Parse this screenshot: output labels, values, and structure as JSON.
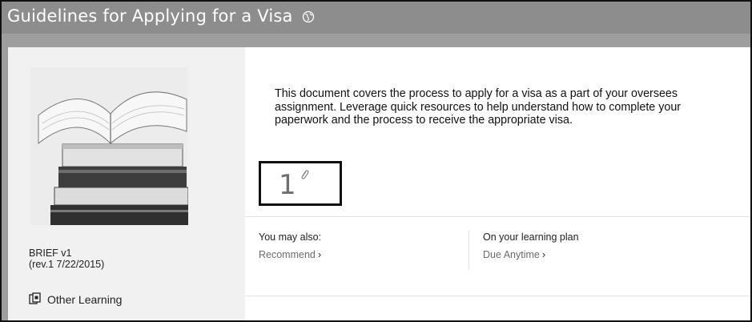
{
  "header": {
    "title": "Guidelines for Applying for a Visa",
    "title_icon": "globe-icon"
  },
  "sidebar": {
    "thumbnail": "books-image",
    "version_line1": "BRIEF v1",
    "version_line2": "(rev.1 7/22/2015)",
    "other_learning_label": "Other Learning",
    "other_learning_icon": "copy-document-icon"
  },
  "main": {
    "description": "This document covers the process to apply for a visa as a part of your oversees assignment. Leverage quick resources to help understand how to complete your paperwork and the process to receive the appropriate visa.",
    "attachment_count": "1",
    "attachment_icon": "paperclip-icon",
    "actions": {
      "you_may_also_label": "You may also:",
      "recommend_label": "Recommend",
      "learning_plan_label": "On your learning plan",
      "due_label": "Due Anytime",
      "chevron": "›"
    }
  },
  "colors": {
    "header_bg": "#8d8d8d",
    "frame_bg": "#9e9e9e",
    "link_text": "#6c6c6c"
  }
}
